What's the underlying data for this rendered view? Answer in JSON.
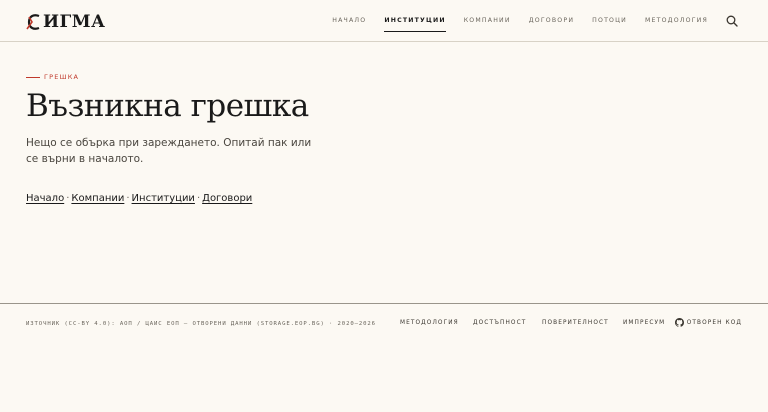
{
  "brand": {
    "logo_text": "ИГМА"
  },
  "nav": {
    "items": [
      {
        "label": "Начало",
        "active": false
      },
      {
        "label": "Институции",
        "active": true
      },
      {
        "label": "Компании",
        "active": false
      },
      {
        "label": "Договори",
        "active": false
      },
      {
        "label": "Потоци",
        "active": false
      },
      {
        "label": "Методология",
        "active": false
      }
    ]
  },
  "error": {
    "eyebrow": "Грешка",
    "title": "Възникна грешка",
    "message": "Нещо се обърка при зареждането. Опитай пак или се върни в началото.",
    "links": [
      {
        "label": "Начало"
      },
      {
        "label": "Компании"
      },
      {
        "label": "Институции"
      },
      {
        "label": "Договори"
      }
    ],
    "separator": "·"
  },
  "footer": {
    "source": "Източник (CC-BY 4.0): АОП / ЦАИС ЕОП — отворени данни (storage.eop.bg) · 2020–2026",
    "links": [
      {
        "label": "Методология"
      },
      {
        "label": "Достъпност"
      },
      {
        "label": "Поверителност"
      },
      {
        "label": "Импресум"
      }
    ],
    "github_label": "Отворен код"
  },
  "colors": {
    "background": "#fcf9f3",
    "accent": "#c0392b",
    "text": "#1a1a1a"
  }
}
